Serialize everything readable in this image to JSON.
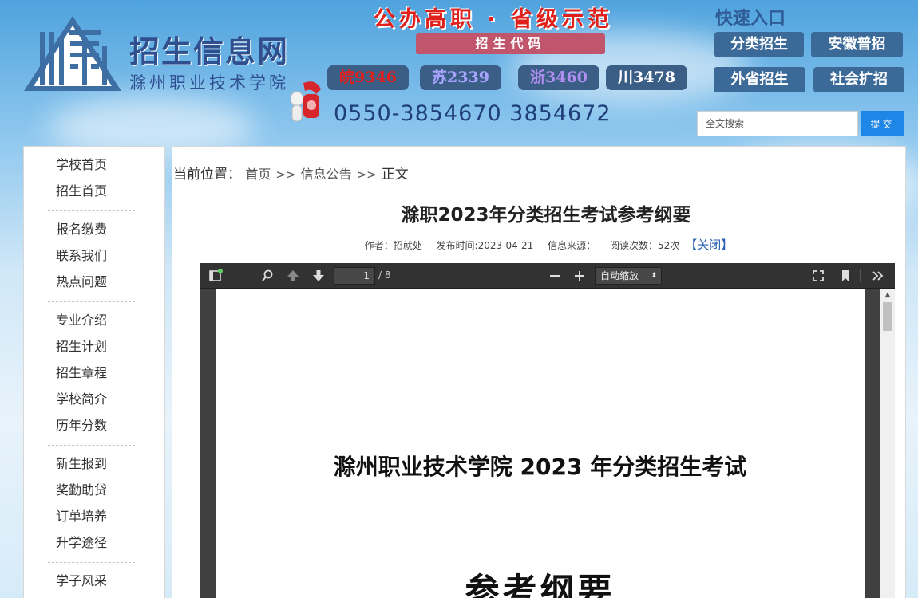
{
  "header": {
    "site_title": "招生信息网",
    "school_name": "滁州职业技术学院",
    "slogan": "公办高职 · 省级示范",
    "code_banner": "招生代码",
    "codes": [
      {
        "label": "皖9346",
        "color": "#e0201b"
      },
      {
        "label": "苏2339",
        "color": "#a9a4ff"
      },
      {
        "label": "浙3460",
        "color": "#b08ff0"
      },
      {
        "label": "川3478",
        "color": "#ffffff"
      }
    ],
    "phone": "0550-3854670  3854672",
    "quick_title": "快速入口",
    "quick_links": [
      "分类招生",
      "安徽普招",
      "外省招生",
      "社会扩招"
    ],
    "search_placeholder": "全文搜索",
    "submit_label": "提交"
  },
  "sidebar": {
    "groups": [
      [
        "学校首页",
        "招生首页"
      ],
      [
        "报名缴费",
        "联系我们",
        "热点问题"
      ],
      [
        "专业介绍",
        "招生计划",
        "招生章程",
        "学校简介",
        "历年分数"
      ],
      [
        "新生报到",
        "奖勤助贷",
        "订单培养",
        "升学途径"
      ],
      [
        "学子风采"
      ]
    ]
  },
  "breadcrumb": {
    "label": "当前位置：",
    "home": "首页",
    "sep": ">>",
    "section": "信息公告",
    "current": "正文"
  },
  "article": {
    "title": "滁职2023年分类招生考试参考纲要",
    "author": "作者：招就处",
    "published": "发布时间:2023-04-21",
    "source": "信息来源：",
    "views": "阅读次数：52次",
    "close": "【关闭】"
  },
  "pdf": {
    "page_current": "1",
    "page_total": "/ 8",
    "zoom": "自动缩放",
    "doc_heading": "滁州职业技术学院 2023 年分类招生考试",
    "doc_sub": "参考纲要"
  }
}
